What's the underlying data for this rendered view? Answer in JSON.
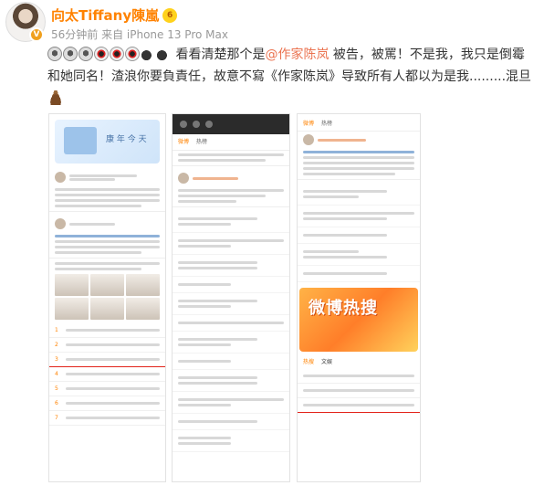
{
  "post": {
    "author": "向太Tiffany陳嵐",
    "meta": "56分钟前 来自 iPhone 13 Pro Max",
    "text_before": "看看清楚那个是",
    "mention": "@作家陈岚",
    "text_after": " 被告，被罵！不是我，我只是倒霉和她同名！渣浪你要負責任，故意不寫《作家陈岚》导致所有人都以为是我.........混旦"
  },
  "screenshots": {
    "s1": {
      "banner_title": "康 年 今 天",
      "hot_items": [
        "1",
        "2",
        "3",
        "4",
        "5",
        "6",
        "7"
      ]
    },
    "s2": {
      "tabs": [
        "微博",
        "热榜"
      ]
    },
    "s3": {
      "tabs": [
        "微博",
        "热榜"
      ],
      "banner_title": "微博热搜",
      "hot_tabs": [
        "热搜",
        "文娱"
      ]
    }
  },
  "colors": {
    "brand": "#ff8200",
    "mention": "#eb7350"
  }
}
